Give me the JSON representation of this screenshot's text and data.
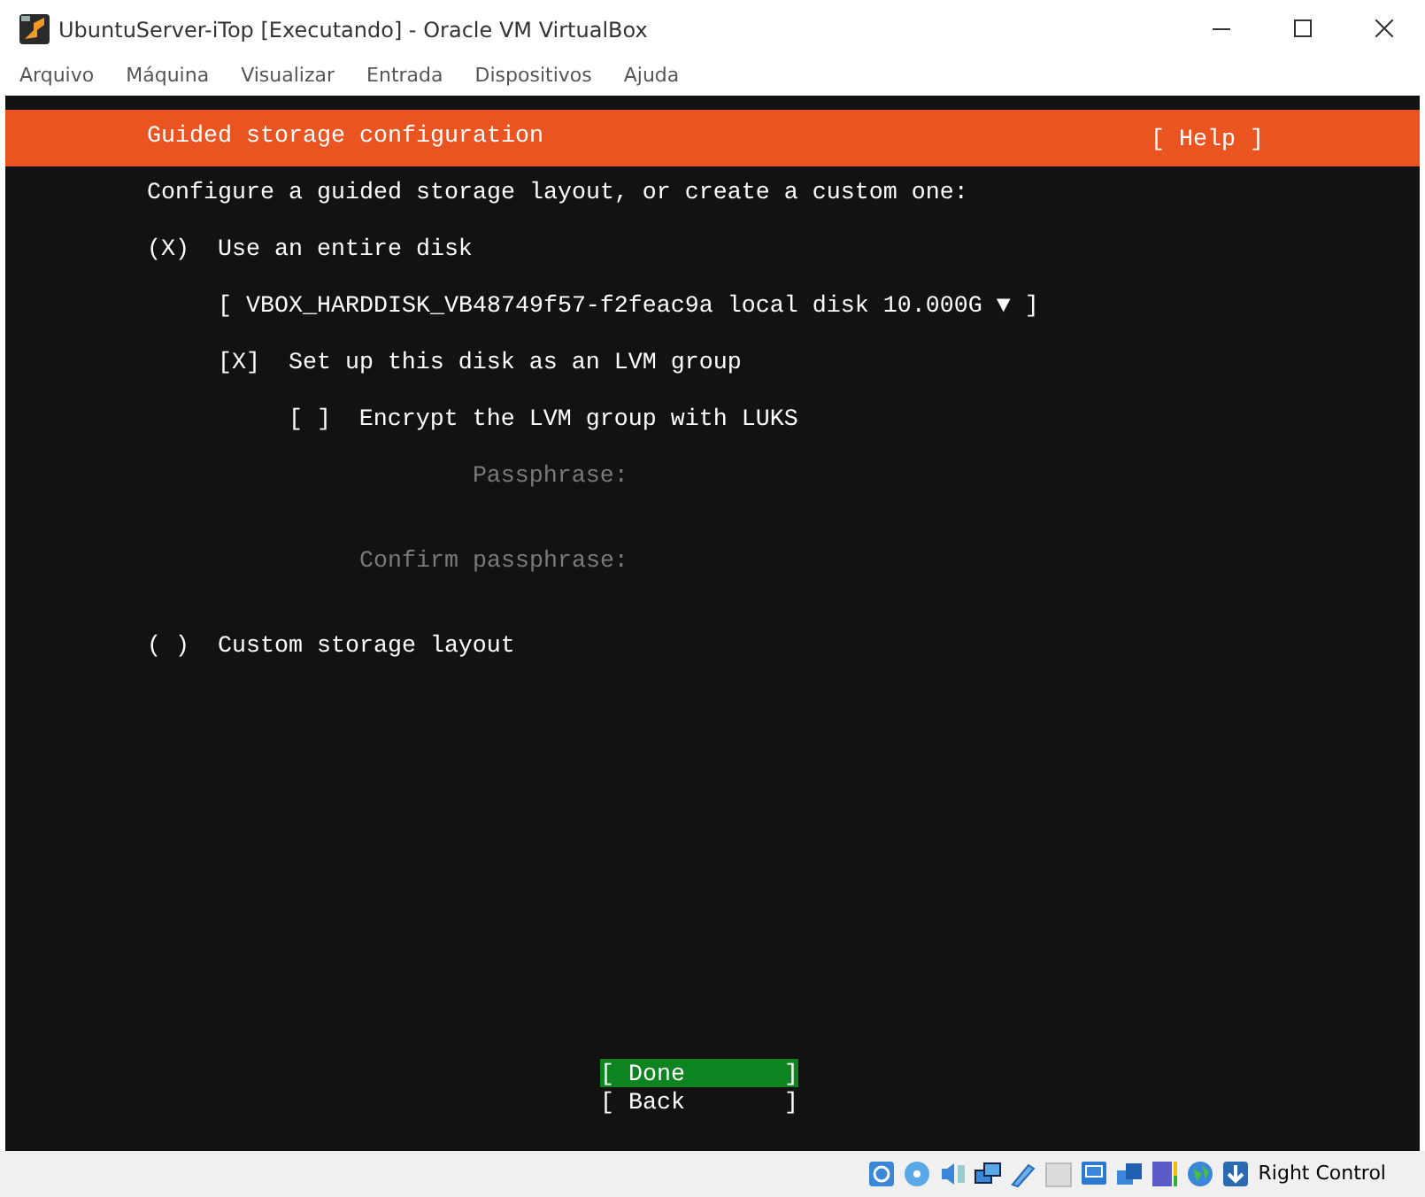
{
  "window": {
    "title": "UbuntuServer-iTop [Executando] - Oracle VM VirtualBox"
  },
  "menu": [
    "Arquivo",
    "Máquina",
    "Visualizar",
    "Entrada",
    "Dispositivos",
    "Ajuda"
  ],
  "screen": {
    "header": {
      "title": "Guided storage configuration",
      "help": "[ Help ]"
    },
    "intro": "Configure a guided storage layout, or create a custom one:",
    "options": [
      {
        "kind": "radio",
        "open": "(",
        "glyph": "X",
        "close": ")",
        "selected": true,
        "label": "Use an entire disk",
        "children": [
          {
            "kind": "dropdown",
            "text": "[ VBOX_HARDDISK_VB48749f57-f2feac9a local disk 10.000G ▼ ]"
          },
          {
            "kind": "checkbox",
            "open": "[",
            "glyph": "X",
            "close": "]",
            "checked": true,
            "label": "Set up this disk as an LVM group",
            "children": [
              {
                "kind": "checkbox",
                "open": "[",
                "close": "]",
                "checked": false,
                "label": "Encrypt the LVM group with LUKS",
                "children": [
                  {
                    "kind": "field",
                    "label": "Passphrase:",
                    "disabled": true
                  },
                  {
                    "kind": "field",
                    "label": "Confirm passphrase:",
                    "disabled": true
                  }
                ]
              }
            ]
          }
        ]
      },
      {
        "kind": "radio",
        "open": "(",
        "close": ")",
        "selected": false,
        "label": "Custom storage layout"
      }
    ],
    "buttons": [
      {
        "label": "[ Done       ]",
        "selected": true
      },
      {
        "label": "[ Back       ]",
        "selected": false
      }
    ]
  },
  "status_bar": {
    "host_key": "Right Control"
  }
}
